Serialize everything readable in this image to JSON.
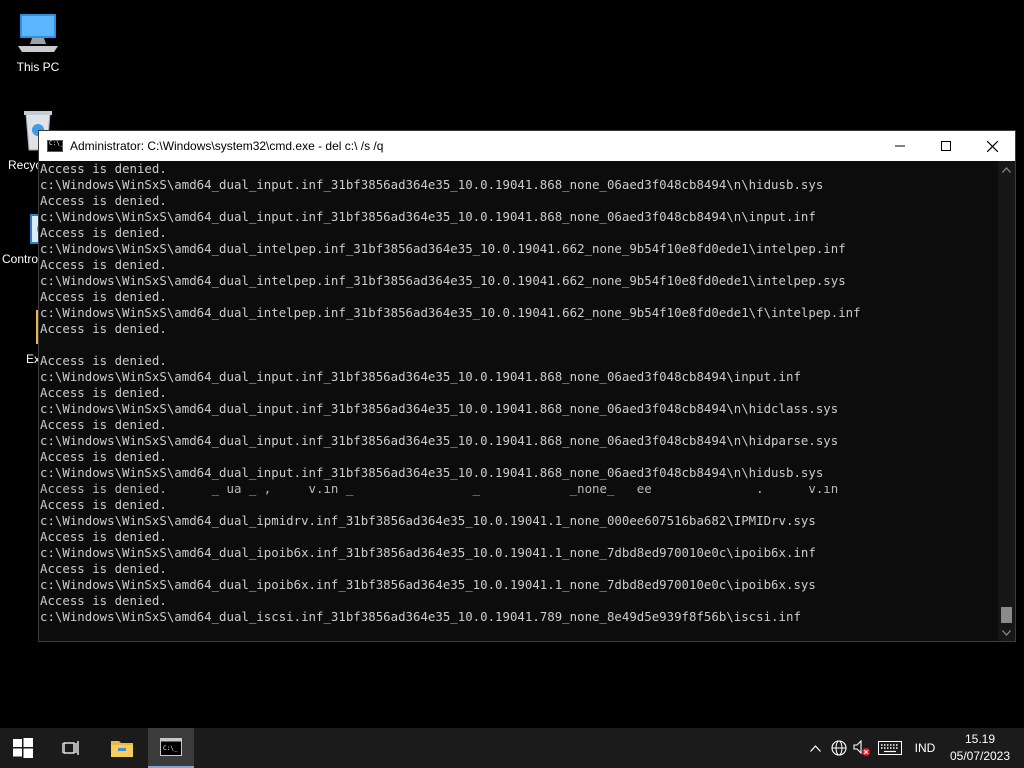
{
  "desktop": {
    "icons": [
      {
        "label": "This PC",
        "icon": "this-pc-icon"
      },
      {
        "label": "Recyc",
        "icon": "recycle-bin-icon"
      },
      {
        "label": "Contro",
        "icon": "control-panel-icon"
      },
      {
        "label": "Ex",
        "icon": "folder-icon"
      }
    ]
  },
  "window": {
    "title": "Administrator: C:\\Windows\\system32\\cmd.exe - del  c:\\ /s /q",
    "minimize_label": "—",
    "maximize_label": "☐",
    "close_label": "✕",
    "console_lines": [
      "Access is denied.",
      "c:\\Windows\\WinSxS\\amd64_dual_input.inf_31bf3856ad364e35_10.0.19041.868_none_06aed3f048cb8494\\n\\hidusb.sys",
      "Access is denied.",
      "c:\\Windows\\WinSxS\\amd64_dual_input.inf_31bf3856ad364e35_10.0.19041.868_none_06aed3f048cb8494\\n\\input.inf",
      "Access is denied.",
      "c:\\Windows\\WinSxS\\amd64_dual_intelpep.inf_31bf3856ad364e35_10.0.19041.662_none_9b54f10e8fd0ede1\\intelpep.inf",
      "Access is denied.",
      "c:\\Windows\\WinSxS\\amd64_dual_intelpep.inf_31bf3856ad364e35_10.0.19041.662_none_9b54f10e8fd0ede1\\intelpep.sys",
      "Access is denied.",
      "c:\\Windows\\WinSxS\\amd64_dual_intelpep.inf_31bf3856ad364e35_10.0.19041.662_none_9b54f10e8fd0ede1\\f\\intelpep.inf",
      "Access is denied.",
      "",
      "Access is denied.",
      "c:\\Windows\\WinSxS\\amd64_dual_input.inf_31bf3856ad364e35_10.0.19041.868_none_06aed3f048cb8494\\input.inf",
      "Access is denied.",
      "c:\\Windows\\WinSxS\\amd64_dual_input.inf_31bf3856ad364e35_10.0.19041.868_none_06aed3f048cb8494\\n\\hidclass.sys",
      "Access is denied.",
      "c:\\Windows\\WinSxS\\amd64_dual_input.inf_31bf3856ad364e35_10.0.19041.868_none_06aed3f048cb8494\\n\\hidparse.sys",
      "Access is denied.",
      "c:\\Windows\\WinSxS\\amd64_dual_input.inf_31bf3856ad364e35_10.0.19041.868_none_06aed3f048cb8494\\n\\hidusb.sys",
      "Access is denied.      _ ua _ ,     v.ın _                _            _none_   ee              .      v.ın",
      "Access is denied.",
      "c:\\Windows\\WinSxS\\amd64_dual_ipmidrv.inf_31bf3856ad364e35_10.0.19041.1_none_000ee607516ba682\\IPMIDrv.sys",
      "Access is denied.",
      "c:\\Windows\\WinSxS\\amd64_dual_ipoib6x.inf_31bf3856ad364e35_10.0.19041.1_none_7dbd8ed970010e0c\\ipoib6x.inf",
      "Access is denied.",
      "c:\\Windows\\WinSxS\\amd64_dual_ipoib6x.inf_31bf3856ad364e35_10.0.19041.1_none_7dbd8ed970010e0c\\ipoib6x.sys",
      "Access is denied.",
      "c:\\Windows\\WinSxS\\amd64_dual_iscsi.inf_31bf3856ad364e35_10.0.19041.789_none_8e49d5e939f8f56b\\iscsi.inf"
    ]
  },
  "taskbar": {
    "start_icon": "windows-logo-icon",
    "task_view_icon": "task-view-icon",
    "explorer_icon": "file-explorer-icon",
    "cmd_icon": "command-prompt-icon",
    "tray": {
      "chevron": "^",
      "language": "IND",
      "time": "15.19",
      "date": "05/07/2023"
    }
  },
  "colors": {
    "desktop_bg": "#000000",
    "console_bg": "#0c0c0c",
    "console_text": "#cccccc",
    "taskbar_bg": "#1b1b1b",
    "titlebar_bg": "#ffffff"
  }
}
